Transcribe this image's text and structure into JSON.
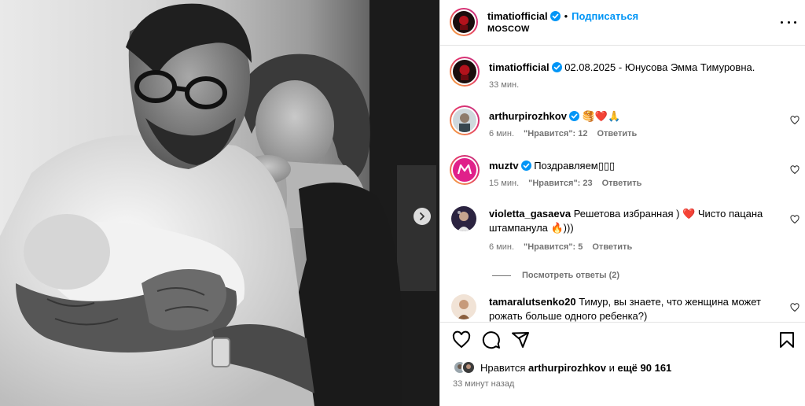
{
  "post": {
    "author": "timatiofficial",
    "follow_label": "Подписаться",
    "dot": "•",
    "location": "MOSCOW"
  },
  "caption": {
    "author": "timatiofficial",
    "text": "02.08.2025 - Юнусова Эмма Тимуровна.",
    "time": "33 мин."
  },
  "comments": [
    {
      "user": "arthurpirozhkov",
      "verified": true,
      "text": "🥞❤️🙏",
      "time": "6 мин.",
      "likes": "\"Нравится\": 12",
      "reply": "Ответить"
    },
    {
      "user": "muztv",
      "verified": true,
      "text": "Поздравляем",
      "text_tail": "▯▯▯",
      "time": "15 мин.",
      "likes": "\"Нравится\": 23",
      "reply": "Ответить"
    },
    {
      "user": "violetta_gasaeva",
      "verified": false,
      "text": "Решетова избранная ) ❤️ Чисто пацана штампанула 🔥)))",
      "time": "6 мин.",
      "likes": "\"Нравится\": 5",
      "reply": "Ответить",
      "view_replies": "Посмотреть ответы (2)"
    },
    {
      "user": "tamaralutsenko20",
      "verified": false,
      "text": "Тимур, вы знаете, что женщина может рожать больше одного ребенка?)"
    }
  ],
  "likes": {
    "prefix": "Нравится",
    "user": "arthurpirozhkov",
    "middle": "и",
    "others": "ещё 90 161"
  },
  "posted_time": "33 минут назад",
  "icons": {
    "verified": "verified-badge-icon",
    "heart": "heart-icon",
    "comment": "comment-icon",
    "share": "share-icon",
    "save": "bookmark-icon",
    "more": "more-options-icon",
    "next": "chevron-right-icon"
  },
  "colors": {
    "accent_blue": "#0095f6",
    "secondary_text": "#737373",
    "border": "#e3e3e3"
  }
}
